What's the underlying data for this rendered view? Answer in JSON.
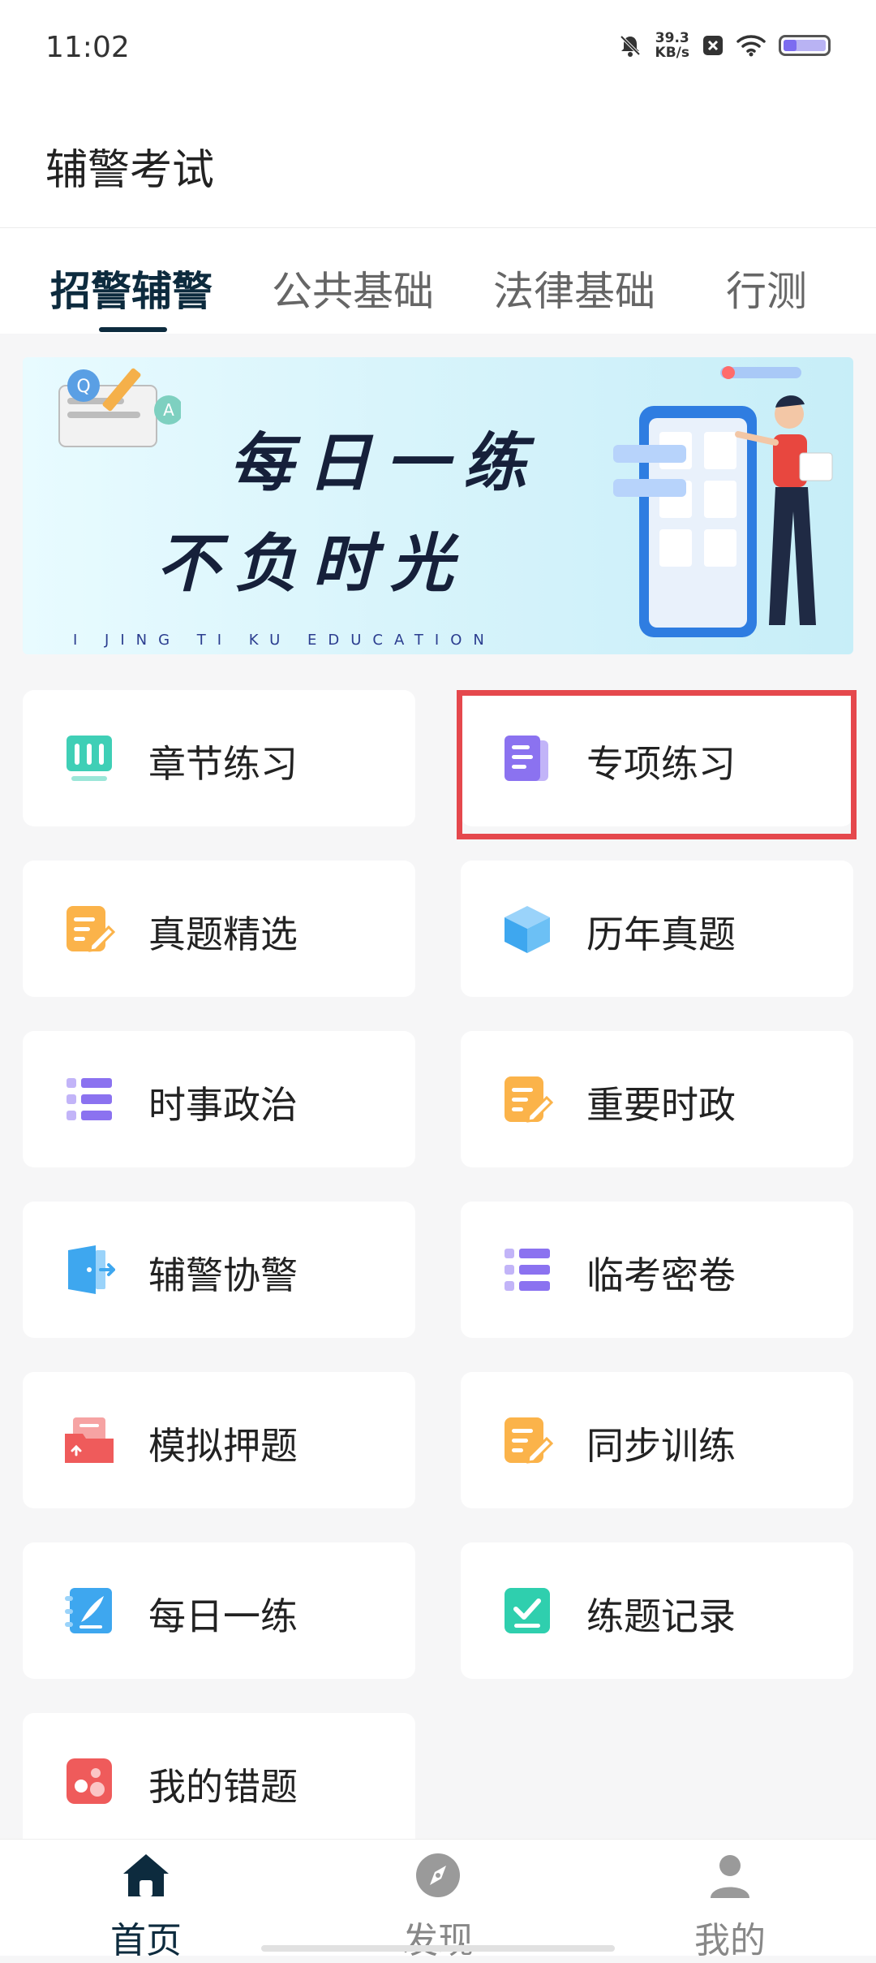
{
  "status_bar": {
    "time": "11:02",
    "speed_value": "39.3",
    "speed_unit": "KB/s"
  },
  "header": {
    "title": "辅警考试"
  },
  "tabs": [
    {
      "label": "招警辅警",
      "active": true
    },
    {
      "label": "公共基础",
      "active": false
    },
    {
      "label": "法律基础",
      "active": false
    },
    {
      "label": "行测",
      "active": false
    }
  ],
  "banner": {
    "line1": "每日一练",
    "line2": "不负时光",
    "subtitle": "I JING TI KU EDUCATION"
  },
  "grid": [
    {
      "label": "章节练习",
      "icon": "bar-chart-icon",
      "color": "#3fcfb6"
    },
    {
      "label": "专项练习",
      "icon": "document-icon",
      "color": "#8b72f0"
    },
    {
      "label": "真题精选",
      "icon": "edit-note-icon",
      "color": "#fbb34a"
    },
    {
      "label": "历年真题",
      "icon": "cube-icon",
      "color": "#3ea7ef"
    },
    {
      "label": "时事政治",
      "icon": "list-icon",
      "color": "#8b72f0"
    },
    {
      "label": "重要时政",
      "icon": "edit-note-icon",
      "color": "#fbb34a"
    },
    {
      "label": "辅警协警",
      "icon": "door-icon",
      "color": "#3ea7ef"
    },
    {
      "label": "临考密卷",
      "icon": "list-icon",
      "color": "#8b72f0"
    },
    {
      "label": "模拟押题",
      "icon": "folder-upload-icon",
      "color": "#ef5b5b"
    },
    {
      "label": "同步训练",
      "icon": "edit-note-icon",
      "color": "#fbb34a"
    },
    {
      "label": "每日一练",
      "icon": "notebook-pen-icon",
      "color": "#3ea7ef"
    },
    {
      "label": "练题记录",
      "icon": "check-box-icon",
      "color": "#2fcfae"
    },
    {
      "label": "我的错题",
      "icon": "error-dots-icon",
      "color": "#ef5b5b"
    }
  ],
  "bottom_nav": [
    {
      "label": "首页",
      "icon": "home-icon",
      "active": true
    },
    {
      "label": "发现",
      "icon": "compass-icon",
      "active": false
    },
    {
      "label": "我的",
      "icon": "user-icon",
      "active": false
    }
  ]
}
